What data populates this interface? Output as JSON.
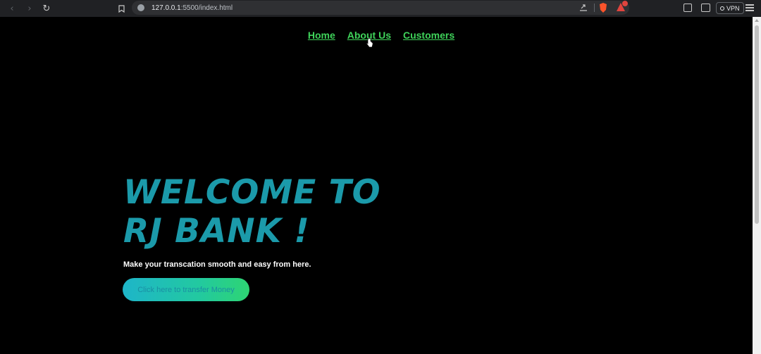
{
  "browser": {
    "url_host": "127.0.0.1",
    "url_path": ":5500/index.html",
    "vpn_label": "VPN",
    "icons": [
      "back-icon",
      "forward-icon",
      "reload-icon",
      "bookmark-icon",
      "site-info-icon",
      "share-icon",
      "brave-shields-icon",
      "brave-rewards-icon",
      "sidebar-icon",
      "wallet-icon",
      "menu-icon"
    ]
  },
  "nav": {
    "items": [
      {
        "label": "Home"
      },
      {
        "label": "About Us"
      },
      {
        "label": "Customers"
      }
    ]
  },
  "hero": {
    "title_line1": "WELCOME TO",
    "title_line2": "RJ BANK !",
    "tagline": "Make your transcation smooth and easy from here.",
    "cta_label": "Click here to transfer Money"
  },
  "colors": {
    "background": "#000000",
    "nav_link": "#3fd35a",
    "title": "#1b9aaa",
    "cta_gradient_start": "#1eb5c9",
    "cta_gradient_end": "#2ed573"
  }
}
